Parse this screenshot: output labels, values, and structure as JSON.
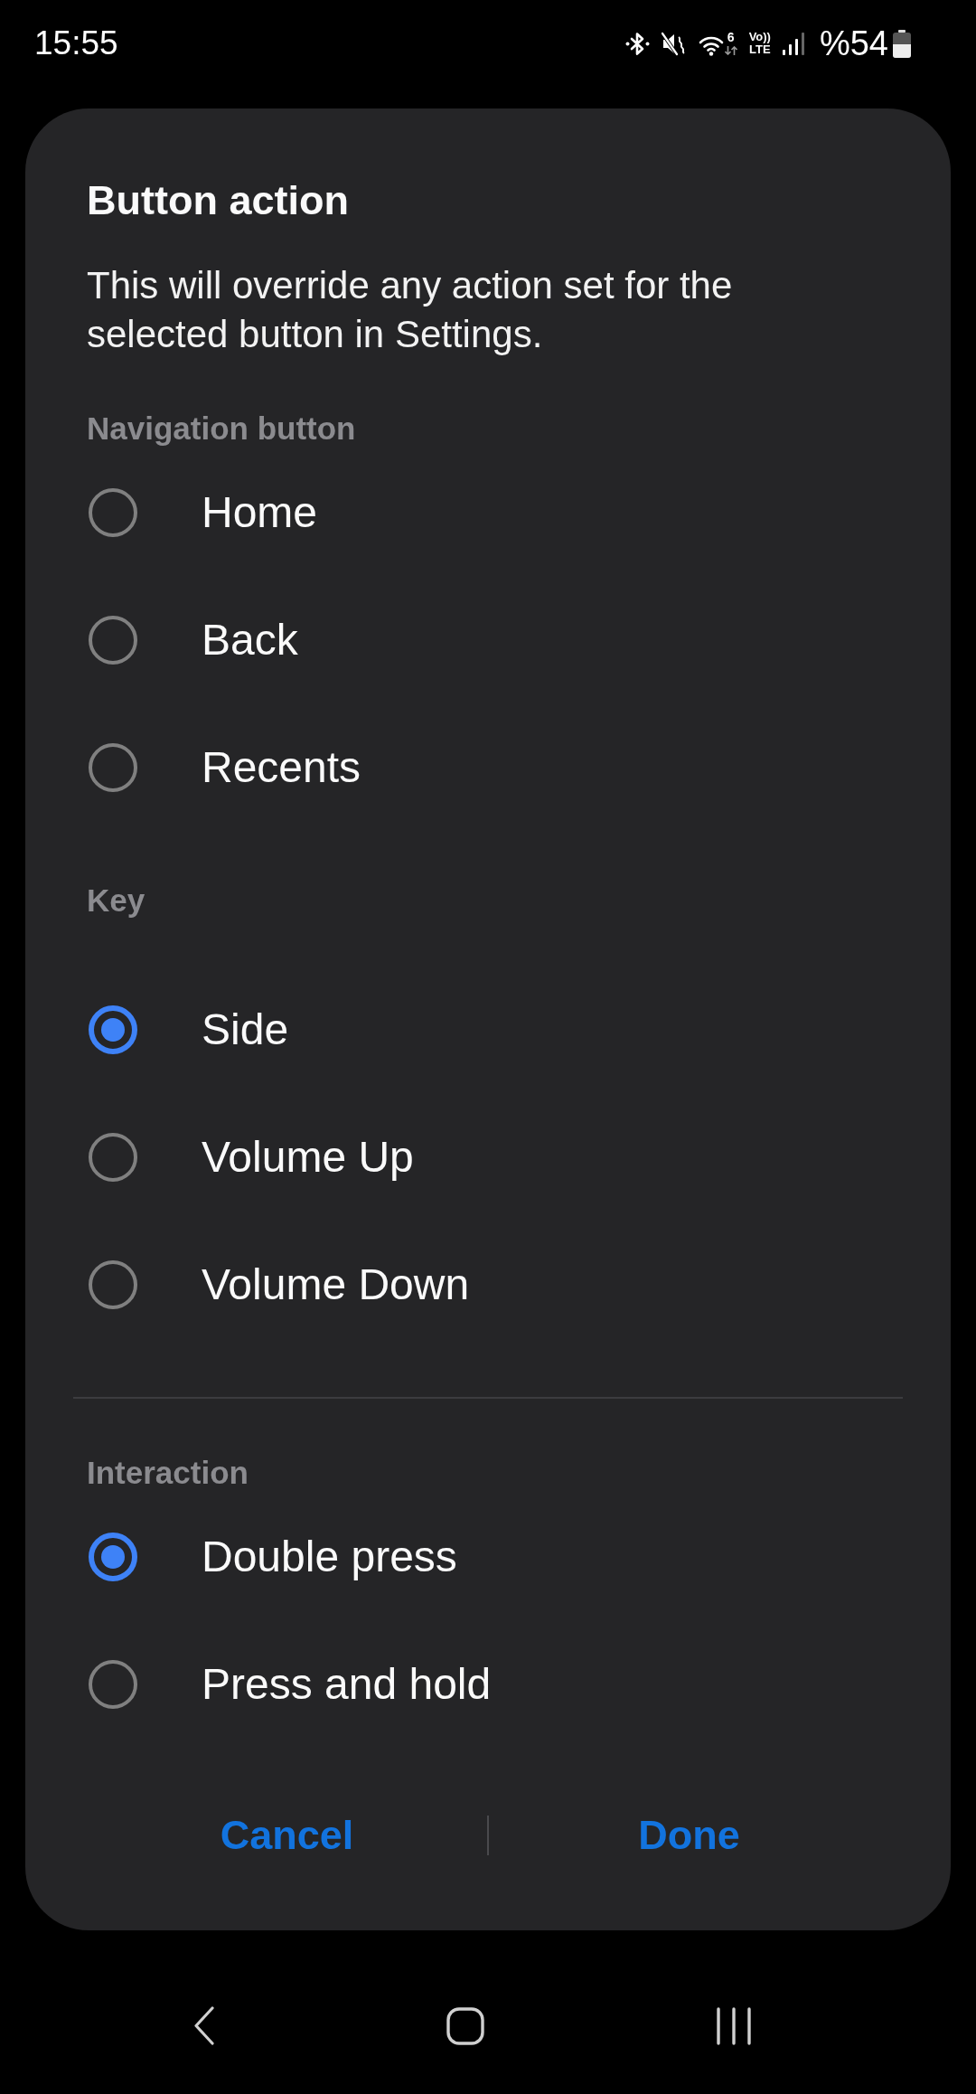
{
  "status_bar": {
    "time": "15:55",
    "wifi_standard": "6",
    "volte_top": "Vo))",
    "volte_bottom": "LTE",
    "battery": "%54"
  },
  "dialog": {
    "title": "Button action",
    "description": "This will override any action set for the selected button in Settings.",
    "sections": [
      {
        "header": "Navigation button",
        "divided": false,
        "options": [
          {
            "label": "Home",
            "selected": false
          },
          {
            "label": "Back",
            "selected": false
          },
          {
            "label": "Recents",
            "selected": false
          }
        ]
      },
      {
        "header": "Key",
        "divided": false,
        "options": [
          {
            "label": "Side",
            "selected": true
          },
          {
            "label": "Volume Up",
            "selected": false
          },
          {
            "label": "Volume Down",
            "selected": false
          }
        ]
      },
      {
        "header": "Interaction",
        "divided": true,
        "options": [
          {
            "label": "Double press",
            "selected": true
          },
          {
            "label": "Press and hold",
            "selected": false
          }
        ]
      }
    ],
    "buttons": [
      {
        "label": "Cancel"
      },
      {
        "label": "Done"
      }
    ]
  }
}
